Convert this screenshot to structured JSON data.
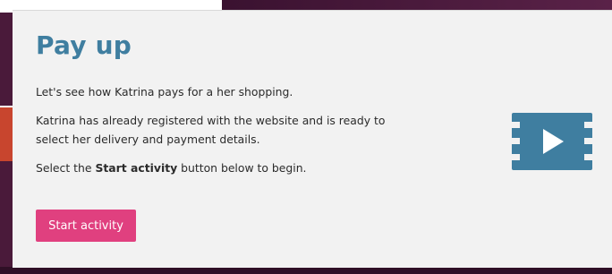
{
  "card": {
    "title": "Pay up",
    "para1": "Let's see how Katrina pays for a her shopping.",
    "para2": "Katrina has already registered with the website and is ready to select her delivery and payment details.",
    "para3_prefix": "Select the ",
    "para3_bold": "Start activity",
    "para3_suffix": " button below to begin.",
    "start_button_label": "Start activity",
    "icon": "video-film-icon"
  },
  "colors": {
    "title": "#3f7ea0",
    "button": "#e0407f",
    "icon": "#3f7ea0",
    "card_bg": "#f2f2f2"
  }
}
